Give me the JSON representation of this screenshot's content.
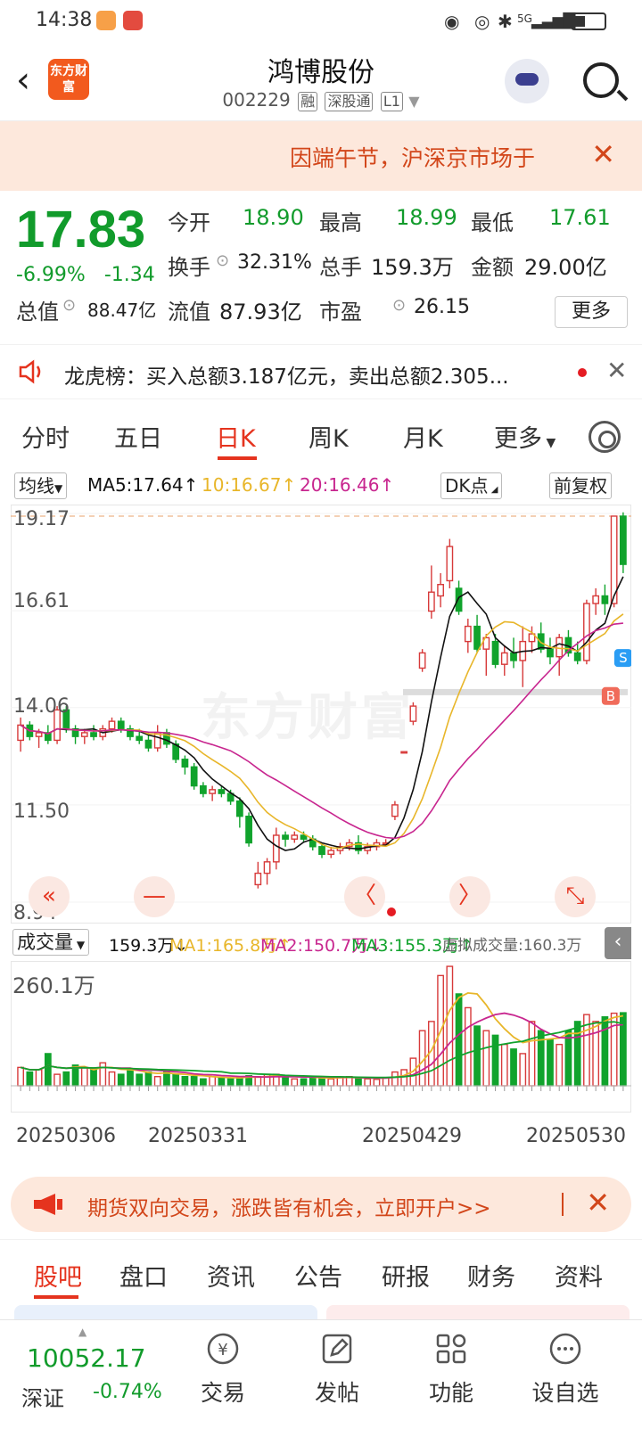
{
  "status_bar": {
    "time": "14:38",
    "network": "5G"
  },
  "header": {
    "back_glyph": "‹",
    "logo_text": "东方财富",
    "title": "鸿博股份",
    "code": "002229",
    "tags": [
      "融",
      "深股通",
      "L1"
    ]
  },
  "notice": {
    "text": "因端午节，沪深京市场于",
    "close": "✕"
  },
  "quote": {
    "price": "17.83",
    "change_pct": "-6.99%",
    "change": "-1.34",
    "fields": [
      {
        "label": "今开",
        "value": "18.90"
      },
      {
        "label": "最高",
        "value": "18.99"
      },
      {
        "label": "最低",
        "value": "17.61"
      },
      {
        "label": "换手",
        "value": "32.31%"
      },
      {
        "label": "总手",
        "value": "159.3万"
      },
      {
        "label": "金额",
        "value": "29.00亿"
      },
      {
        "label": "总值",
        "value": "88.47亿"
      },
      {
        "label": "流值",
        "value": "87.93亿"
      },
      {
        "label": "市盈",
        "value": "26.15"
      }
    ],
    "more": "更多"
  },
  "dragon": {
    "text": "龙虎榜：买入总额3.187亿元，卖出总额2.305...",
    "close": "✕"
  },
  "chart_tabs": [
    "分时",
    "五日",
    "日K",
    "周K",
    "月K",
    "更多"
  ],
  "indicator": {
    "select": "均线",
    "ma5": "MA5:17.64↑",
    "ma10": "10:16.67↑",
    "ma20": "20:16.46↑",
    "dk": "DK点",
    "adjust": "前复权"
  },
  "price_axis": [
    "19.17",
    "16.61",
    "14.06",
    "11.50",
    "8.94"
  ],
  "watermark": "东方财富",
  "controls": [
    "«",
    "—",
    "〈",
    "〉",
    "⤡"
  ],
  "volume": {
    "select": "成交量",
    "total": "159.3万↓",
    "ma1": "MA1:165.8万↑",
    "ma2": "MA2:150.7万↓",
    "ma3": "MA3:155.3万↑",
    "virtual": "虚拟成交量:160.3万",
    "max_label": "260.1万",
    "collapse": "‹"
  },
  "dates": [
    "20250306",
    "20250331",
    "20250429",
    "20250530"
  ],
  "futures": {
    "text": "期货双向交易，涨跌皆有机会，立即开户>>",
    "close": "✕"
  },
  "bottom_tabs": [
    "股吧",
    "盘口",
    "资讯",
    "公告",
    "研报",
    "财务",
    "资料"
  ],
  "bottom_bar": {
    "index_value": "10052.17",
    "index_name": "深证",
    "index_pct": "-0.74%",
    "items": [
      "交易",
      "发帖",
      "功能",
      "设自选"
    ]
  },
  "colors": {
    "up": "#d73a3a",
    "down": "#10a32c",
    "ma5": "#111111",
    "ma10": "#e8b62a",
    "ma20": "#c8268f",
    "accent": "#e5331e"
  },
  "chart_data": [
    {
      "type": "candlestick",
      "y_axis_ticks": [
        19.17,
        16.61,
        14.06,
        11.5,
        8.94
      ],
      "ylim": [
        8.94,
        19.17
      ],
      "x_tick_labels": [
        "20250306",
        "20250331",
        "20250429",
        "20250530"
      ],
      "candles": [
        [
          13.2,
          13.8,
          12.9,
          13.6
        ],
        [
          13.6,
          13.7,
          13.2,
          13.3
        ],
        [
          13.3,
          13.5,
          13.0,
          13.4
        ],
        [
          13.4,
          13.6,
          13.1,
          13.2
        ],
        [
          13.2,
          14.1,
          13.1,
          14.0
        ],
        [
          14.0,
          14.1,
          13.4,
          13.5
        ],
        [
          13.5,
          13.6,
          13.1,
          13.3
        ],
        [
          13.3,
          13.5,
          13.1,
          13.4
        ],
        [
          13.4,
          13.6,
          13.2,
          13.3
        ],
        [
          13.3,
          13.6,
          13.2,
          13.5
        ],
        [
          13.5,
          13.8,
          13.4,
          13.7
        ],
        [
          13.7,
          13.8,
          13.4,
          13.5
        ],
        [
          13.5,
          13.6,
          13.2,
          13.3
        ],
        [
          13.3,
          13.5,
          13.1,
          13.2
        ],
        [
          13.2,
          13.4,
          12.9,
          13.0
        ],
        [
          13.0,
          13.6,
          12.9,
          13.4
        ],
        [
          13.4,
          13.5,
          13.0,
          13.1
        ],
        [
          13.1,
          13.2,
          12.6,
          12.7
        ],
        [
          12.7,
          12.8,
          12.3,
          12.5
        ],
        [
          12.5,
          12.6,
          11.9,
          12.0
        ],
        [
          12.0,
          12.1,
          11.7,
          11.8
        ],
        [
          11.8,
          12.0,
          11.6,
          11.9
        ],
        [
          11.9,
          12.0,
          11.7,
          11.8
        ],
        [
          11.8,
          11.9,
          11.5,
          11.6
        ],
        [
          11.6,
          11.7,
          10.9,
          11.2
        ],
        [
          11.2,
          11.3,
          10.4,
          10.5
        ],
        [
          9.4,
          10.0,
          9.3,
          9.7
        ],
        [
          9.7,
          10.1,
          9.4,
          10.0
        ],
        [
          10.0,
          10.9,
          9.8,
          10.7
        ],
        [
          10.7,
          10.8,
          10.4,
          10.6
        ],
        [
          10.6,
          10.8,
          10.5,
          10.7
        ],
        [
          10.7,
          10.8,
          10.5,
          10.6
        ],
        [
          10.6,
          10.7,
          10.3,
          10.4
        ],
        [
          10.4,
          10.5,
          10.1,
          10.2
        ],
        [
          10.2,
          10.4,
          10.1,
          10.3
        ],
        [
          10.3,
          10.5,
          10.2,
          10.4
        ],
        [
          10.4,
          10.6,
          10.3,
          10.5
        ],
        [
          10.5,
          10.7,
          10.2,
          10.3
        ],
        [
          10.3,
          10.5,
          10.2,
          10.4
        ],
        [
          10.4,
          10.6,
          10.3,
          10.5
        ],
        [
          10.5,
          10.6,
          10.4,
          10.5
        ],
        [
          11.2,
          11.6,
          11.1,
          11.5
        ],
        [
          12.9,
          12.9,
          12.9,
          12.9
        ],
        [
          13.7,
          14.2,
          13.6,
          14.1
        ],
        [
          15.1,
          15.6,
          15.0,
          15.5
        ],
        [
          16.6,
          17.8,
          16.4,
          17.1
        ],
        [
          17.0,
          17.6,
          16.7,
          17.3
        ],
        [
          17.4,
          18.5,
          17.2,
          18.3
        ],
        [
          17.2,
          17.4,
          16.5,
          16.6
        ],
        [
          15.8,
          16.4,
          15.5,
          16.2
        ],
        [
          16.2,
          16.5,
          15.5,
          15.6
        ],
        [
          15.6,
          16.0,
          14.9,
          15.9
        ],
        [
          15.8,
          16.0,
          15.1,
          15.2
        ],
        [
          15.2,
          15.7,
          14.9,
          15.5
        ],
        [
          15.5,
          15.9,
          15.1,
          15.3
        ],
        [
          15.3,
          16.2,
          14.6,
          15.8
        ],
        [
          15.8,
          16.2,
          15.5,
          16.0
        ],
        [
          16.0,
          16.3,
          15.5,
          15.6
        ],
        [
          15.6,
          15.9,
          15.2,
          15.4
        ],
        [
          15.4,
          16.0,
          14.9,
          15.9
        ],
        [
          15.9,
          16.1,
          15.4,
          15.5
        ],
        [
          15.5,
          15.8,
          15.2,
          15.3
        ],
        [
          15.3,
          16.9,
          15.2,
          16.8
        ],
        [
          16.8,
          17.2,
          16.5,
          17.0
        ],
        [
          17.0,
          17.3,
          16.5,
          16.8
        ],
        [
          16.8,
          19.1,
          16.7,
          19.1
        ],
        [
          19.1,
          19.2,
          17.6,
          17.83
        ]
      ],
      "volume": {
        "ylim": [
          0,
          260.1
        ],
        "unit": "万",
        "values": [
          40,
          30,
          35,
          70,
          25,
          30,
          45,
          40,
          35,
          50,
          30,
          25,
          35,
          25,
          30,
          20,
          30,
          25,
          20,
          20,
          15,
          20,
          18,
          15,
          18,
          22,
          20,
          25,
          25,
          18,
          15,
          15,
          20,
          18,
          15,
          18,
          20,
          16,
          15,
          14,
          18,
          30,
          35,
          60,
          120,
          140,
          240,
          260,
          200,
          170,
          130,
          120,
          110,
          90,
          80,
          70,
          140,
          120,
          100,
          90,
          120,
          140,
          155,
          140,
          150,
          158,
          159
        ]
      }
    }
  ]
}
